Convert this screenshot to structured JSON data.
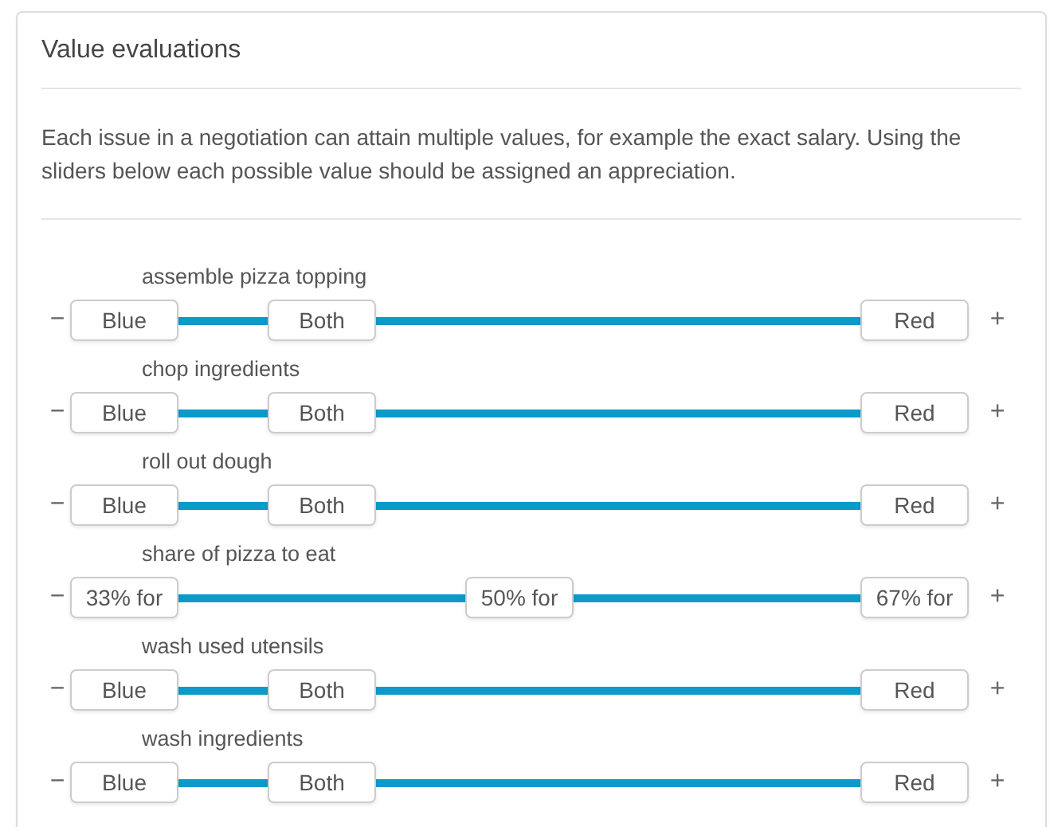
{
  "panel": {
    "title": "Value evaluations",
    "description": "Each issue in a negotiation can attain multiple values, for example the exact salary. Using the sliders below each possible value should be assigned an appreciation."
  },
  "issues": [
    {
      "name": "assemble pizza topping",
      "minus": "−",
      "plus": "+",
      "handles": [
        {
          "label": "Blue",
          "level": 0
        },
        {
          "label": "Both",
          "level": 0.25
        },
        {
          "label": "Red",
          "level": 1
        }
      ]
    },
    {
      "name": "chop ingredients",
      "minus": "−",
      "plus": "+",
      "handles": [
        {
          "label": "Blue",
          "level": 0
        },
        {
          "label": "Both",
          "level": 0.25
        },
        {
          "label": "Red",
          "level": 1
        }
      ]
    },
    {
      "name": "roll out dough",
      "minus": "−",
      "plus": "+",
      "handles": [
        {
          "label": "Blue",
          "level": 0
        },
        {
          "label": "Both",
          "level": 0.25
        },
        {
          "label": "Red",
          "level": 1
        }
      ]
    },
    {
      "name": "share of pizza to eat",
      "minus": "−",
      "plus": "+",
      "handles": [
        {
          "label": "33% for",
          "level": 0
        },
        {
          "label": "50% for",
          "level": 0.5
        },
        {
          "label": "67% for",
          "level": 1
        }
      ]
    },
    {
      "name": "wash used utensils",
      "minus": "−",
      "plus": "+",
      "handles": [
        {
          "label": "Blue",
          "level": 0
        },
        {
          "label": "Both",
          "level": 0.25
        },
        {
          "label": "Red",
          "level": 1
        }
      ]
    },
    {
      "name": "wash ingredients",
      "minus": "−",
      "plus": "+",
      "handles": [
        {
          "label": "Blue",
          "level": 0
        },
        {
          "label": "Both",
          "level": 0.25
        },
        {
          "label": "Red",
          "level": 1
        }
      ]
    }
  ]
}
